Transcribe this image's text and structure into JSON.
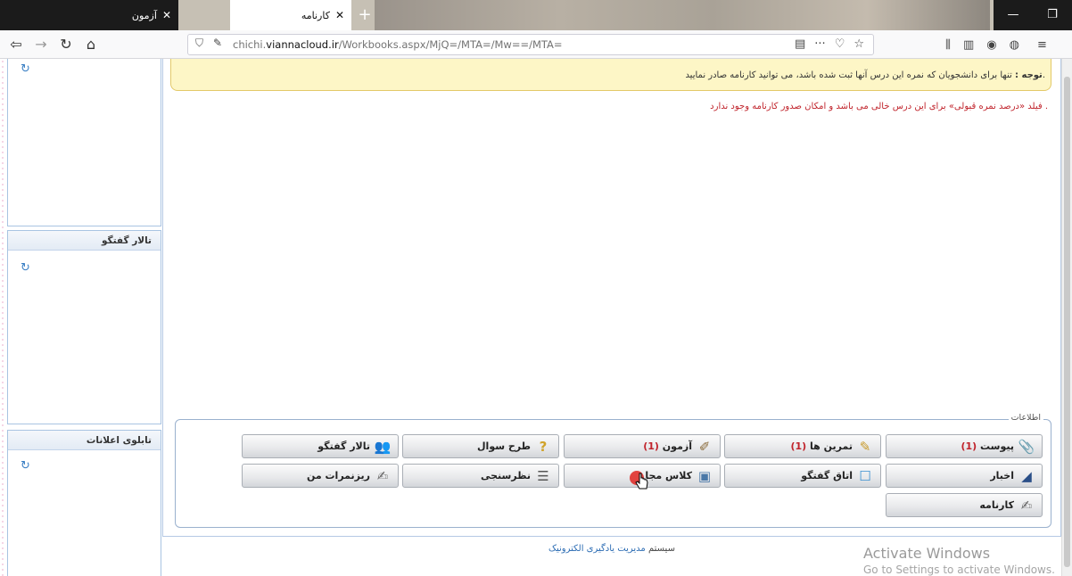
{
  "browser": {
    "tabs": [
      {
        "label": "آزمون",
        "close": "✕"
      },
      {
        "label": "کارنامه",
        "close": "✕"
      }
    ],
    "new_tab": "+",
    "url_prefix": "chichi.",
    "url_domain": "viannacloud.ir",
    "url_path": "/Workbooks.aspx/MjQ=/MTA=/Mw==/MTA=",
    "icons": [
      "back-icon",
      "forward-icon",
      "reload-icon",
      "home-icon",
      "shield-icon",
      "insecure-lock-icon",
      "reader-icon",
      "more-icon",
      "pocket-icon",
      "bookmark-star-icon",
      "library-icon",
      "sidebar-icon",
      "account-icon",
      "extension-icon",
      "menu-icon"
    ]
  },
  "sidebar": {
    "panels": [
      {
        "title": ""
      },
      {
        "title": "تالار گفتگو"
      },
      {
        "title": "تابلوی اعلانات"
      }
    ]
  },
  "main": {
    "notice_label": "توجه :",
    "notice_text": "تنها برای دانشجویان که نمره این درس آنها ثبت شده باشد، می توانید کارنامه صادر نمایید.",
    "warning": "فیلد «درصد نمره قبولی» برای این درس خالی می باشد و امکان صدور کارنامه وجود ندارد .",
    "info_legend": "اطلاعات",
    "buttons": {
      "row1": [
        {
          "label": "پیوست",
          "count": "(1)",
          "icon": "paperclip-icon"
        },
        {
          "label": "تمرین ها",
          "count": "(1)",
          "icon": "homework-icon"
        },
        {
          "label": "آزمون",
          "count": "(1)",
          "icon": "exam-icon"
        },
        {
          "label": "طرح سوال",
          "count": "",
          "icon": "question-icon"
        },
        {
          "label": "تالار گفتگو",
          "count": "",
          "icon": "forum-icon"
        }
      ],
      "row2": [
        {
          "label": "اخبار",
          "count": "",
          "icon": "news-icon"
        },
        {
          "label": "اتاق گفتگو",
          "count": "",
          "icon": "chat-room-icon"
        },
        {
          "label": "کلاس مجا",
          "count": "",
          "icon": "virtual-class-icon"
        },
        {
          "label": "نظرسنجی",
          "count": "",
          "icon": "survey-icon"
        },
        {
          "label": "ریزنمرات من",
          "count": "",
          "icon": "grades-icon"
        }
      ],
      "row3": [
        {
          "label": "کارنامه",
          "count": "",
          "icon": "report-card-icon"
        }
      ]
    }
  },
  "footer": {
    "prefix": "سیستم ",
    "link": "مدیریت یادگیری الکترونیک"
  },
  "os_overlay": {
    "line1": "Activate Windows",
    "line2": "Go to Settings to activate Windows."
  }
}
